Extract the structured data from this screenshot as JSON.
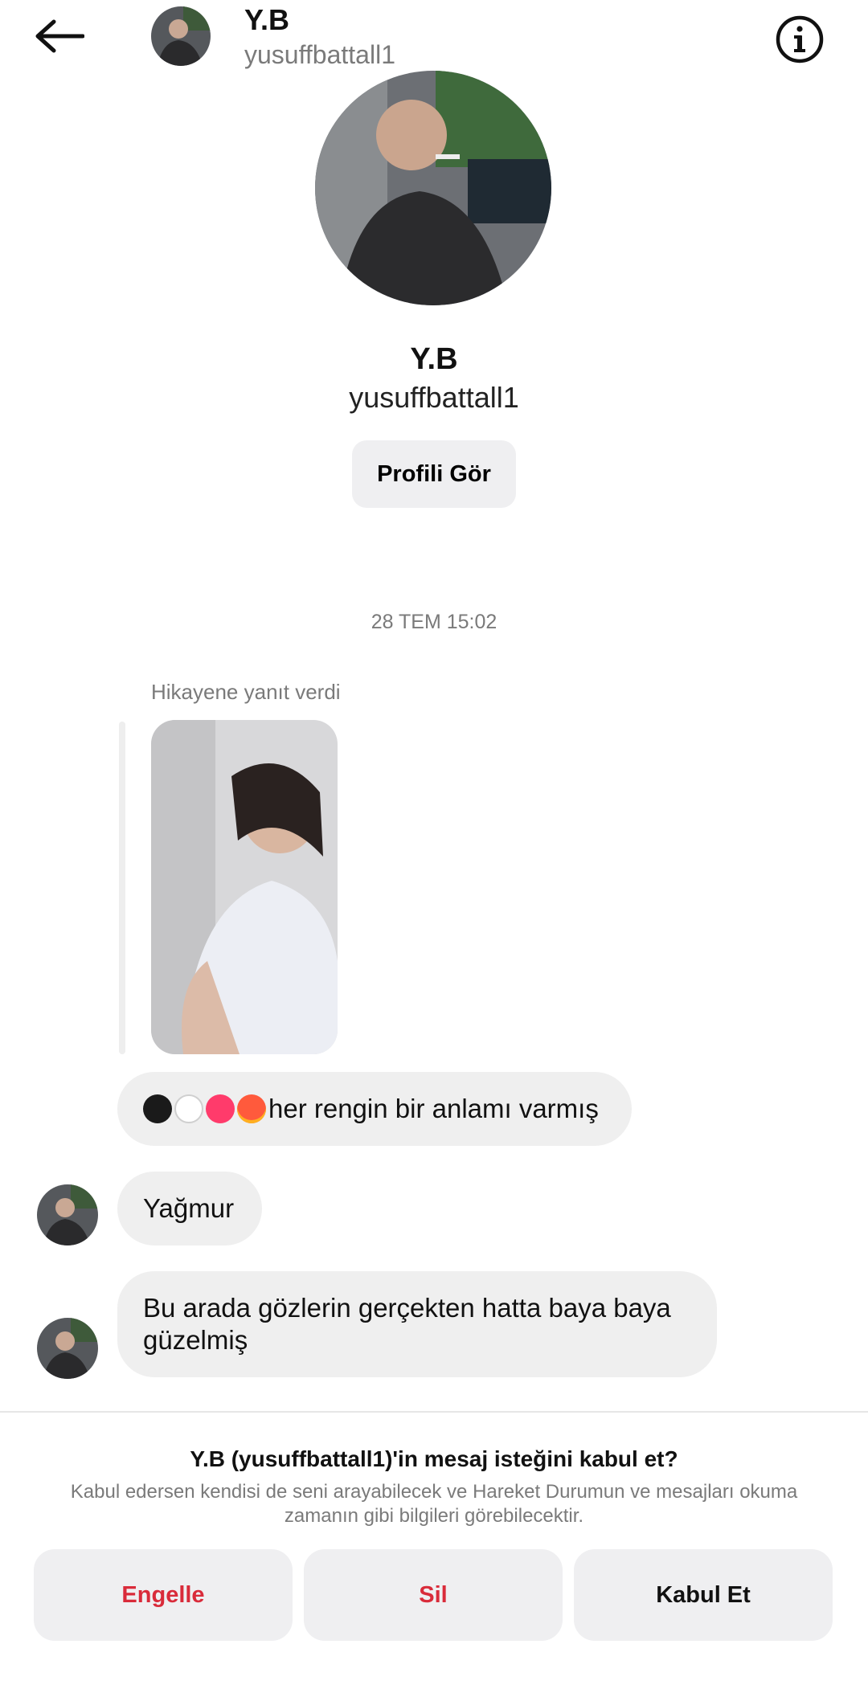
{
  "header": {
    "name": "Y.B",
    "username": "yusuffbattall1",
    "back_icon": "arrow-left-icon",
    "info_icon": "info-circle-icon"
  },
  "profile": {
    "name": "Y.B",
    "username": "yusuffbattall1",
    "view_profile_label": "Profili Gör"
  },
  "thread": {
    "timestamp": "28 TEM 15:02",
    "story_reply_label": "Hikayene yanıt verdi",
    "messages": [
      {
        "text": "her rengin bir anlamı varmış",
        "emojis": [
          "black-heart",
          "white-heart",
          "pink-heart",
          "heart-on-fire"
        ]
      },
      {
        "text": "Yağmur"
      },
      {
        "text": "Bu arada gözlerin gerçekten hatta baya baya güzelmiş"
      }
    ]
  },
  "request": {
    "title": "Y.B (yusuffbattall1)'in mesaj isteğini kabul et?",
    "description": "Kabul edersen kendisi de seni arayabilecek ve Hareket Durumun ve mesajları okuma zamanın gibi bilgileri görebilecektir.",
    "block_label": "Engelle",
    "delete_label": "Sil",
    "accept_label": "Kabul Et"
  },
  "colors": {
    "danger": "#d92b3a",
    "bubble": "#efefef",
    "muted": "#7a7a7a"
  }
}
